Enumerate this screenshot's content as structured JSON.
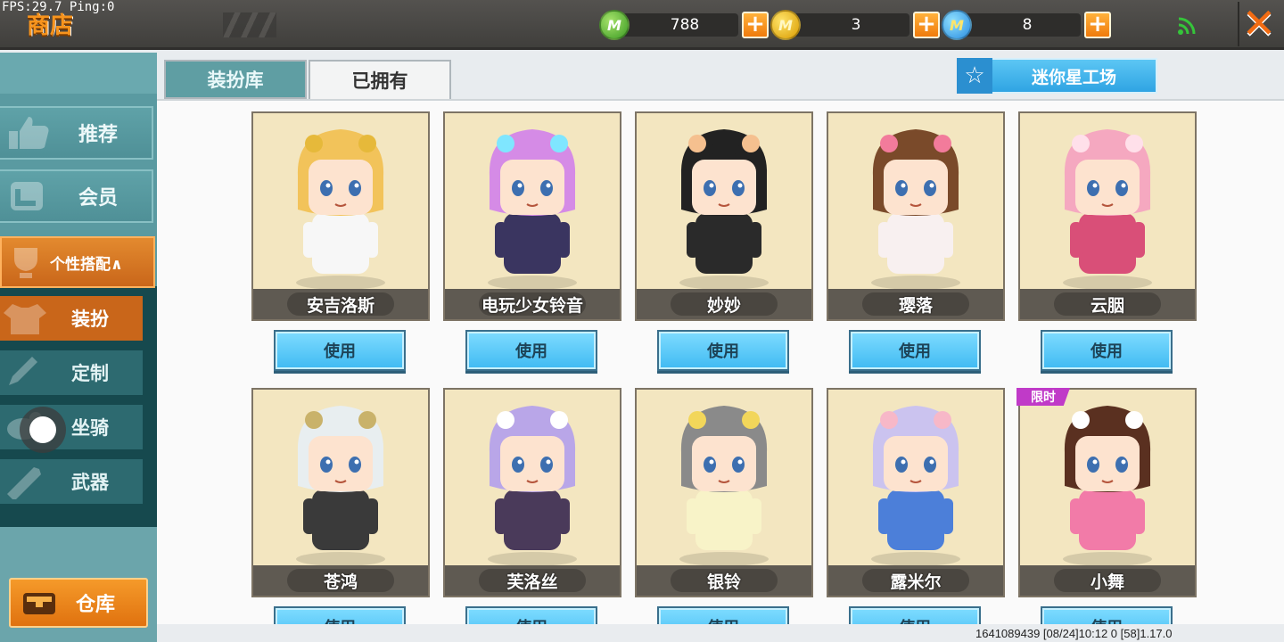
{
  "status": {
    "fps": "FPS:29.7  Ping:0"
  },
  "header": {
    "title": "商店",
    "currencies": [
      {
        "icon": "green-m-coin-icon",
        "amount": "788",
        "symbol": "M"
      },
      {
        "icon": "gold-m-coin-icon",
        "amount": "3",
        "symbol": "M"
      },
      {
        "icon": "blue-m-coin-icon",
        "amount": "8",
        "symbol": "M"
      }
    ],
    "plus_symbol": "+",
    "close_symbol": "✕"
  },
  "sidebar": {
    "items": [
      {
        "label": "推荐",
        "icon": "thumbs-up-icon"
      },
      {
        "label": "会员",
        "icon": "member-icon"
      }
    ],
    "category": {
      "label": "个性搭配∧",
      "icon": "trophy-icon"
    },
    "sub_items": [
      {
        "label": "装扮",
        "icon": "shirt-icon",
        "active": true
      },
      {
        "label": "定制",
        "icon": "pencil-icon",
        "active": false
      },
      {
        "label": "坐骑",
        "icon": "mount-icon",
        "active": false
      },
      {
        "label": "武器",
        "icon": "weapon-icon",
        "active": false
      }
    ],
    "warehouse": {
      "label": "仓库",
      "icon": "chest-icon"
    }
  },
  "tabs": [
    {
      "label": "装扮库",
      "active": false
    },
    {
      "label": "已拥有",
      "active": true
    }
  ],
  "mini_workshop": {
    "label": "迷你星工场",
    "icon": "star-icon"
  },
  "use_label": "使用",
  "limited_label": "限时",
  "skins": [
    {
      "name": "安吉洛斯",
      "hair": "#f2c35a",
      "outfit": "#f7f7f7",
      "accent": "#e6b93a"
    },
    {
      "name": "电玩少女铃音",
      "hair": "#d58be6",
      "outfit": "#3a3560",
      "accent": "#7fe6ff"
    },
    {
      "name": "妙妙",
      "hair": "#222222",
      "outfit": "#2a2a2a",
      "accent": "#f5c08f"
    },
    {
      "name": "璎落",
      "hair": "#7a4a2a",
      "outfit": "#f8f0f0",
      "accent": "#f27b9b"
    },
    {
      "name": "云胭",
      "hair": "#f5a8c0",
      "outfit": "#d94f78",
      "accent": "#ffe0ea"
    },
    {
      "name": "苍鸿",
      "hair": "#e8eef0",
      "outfit": "#3a3a3a",
      "accent": "#c9b26a"
    },
    {
      "name": "芙洛丝",
      "hair": "#b9a6e8",
      "outfit": "#4a3a5a",
      "accent": "#ffffff"
    },
    {
      "name": "银铃",
      "hair": "#8a8a8a",
      "outfit": "#f8f3c8",
      "accent": "#f2d65a"
    },
    {
      "name": "露米尔",
      "hair": "#cbc3ef",
      "outfit": "#4c7fd9",
      "accent": "#f7b8c8"
    },
    {
      "name": "小舞",
      "hair": "#5a3020",
      "outfit": "#f27ba8",
      "accent": "#ffffff",
      "limited": true
    }
  ],
  "footer": "1641089439    [08/24]10:12 0    [58]1.17.0"
}
